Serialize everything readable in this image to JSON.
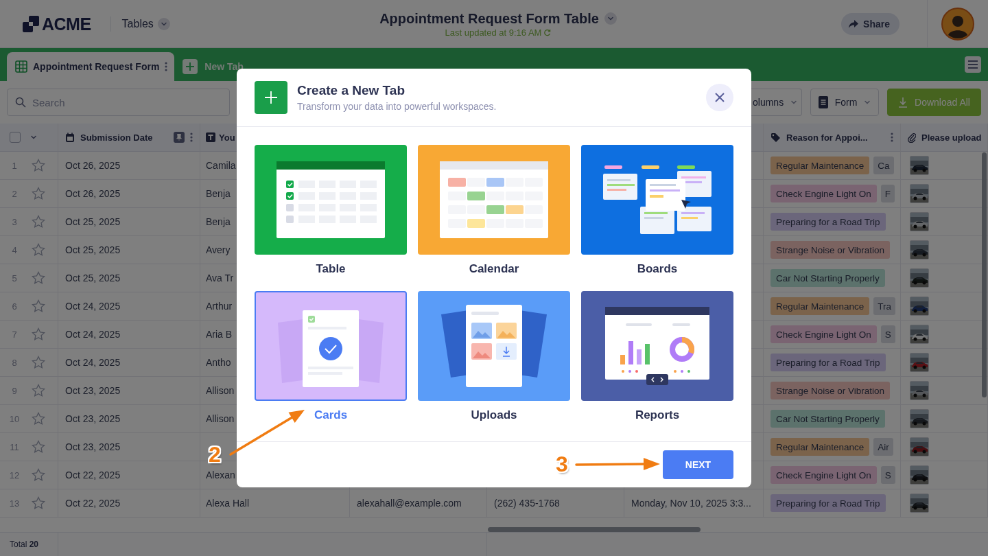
{
  "header": {
    "brand": "ACME",
    "section": "Tables",
    "title": "Appointment Request Form Table",
    "last_updated": "Last updated at 9:16 AM",
    "share": "Share"
  },
  "tabs": [
    {
      "label": "Appointment Request Form",
      "selected": true
    }
  ],
  "new_tab": "New Tab",
  "toolbar": {
    "search": {
      "placeholder": "Search"
    },
    "columns": "olumns",
    "view": "Form",
    "download": "Download All"
  },
  "table": {
    "select_all": {
      "checked": false
    },
    "columns": [
      {
        "kind": "date",
        "label": "Submission Date",
        "pinned": true
      },
      {
        "kind": "text",
        "label": "You"
      },
      {
        "kind": "tags",
        "label": "Reason for Appoi..."
      },
      {
        "kind": "file",
        "label": "Please upload"
      }
    ],
    "rows": [
      {
        "number": "1",
        "starred": false,
        "date": "Oct 26, 2025",
        "name": "Camila",
        "reason": {
          "text": "Regular Maintenance",
          "color": "#7b634b"
        },
        "more": "Ca"
      },
      {
        "number": "2",
        "starred": false,
        "date": "Oct 26, 2025",
        "name": "Benja",
        "reason": {
          "text": "Check Engine Light On",
          "color": "#7a6472"
        },
        "more": "F"
      },
      {
        "number": "3",
        "starred": false,
        "date": "Oct 25, 2025",
        "name": "Benja",
        "reason": {
          "text": "Preparing for a Road Trip",
          "color": "#6b667b"
        }
      },
      {
        "number": "4",
        "starred": false,
        "date": "Oct 25, 2025",
        "name": "Avery",
        "reason": {
          "text": "Strange Noise or Vibration",
          "color": "#7b6360"
        }
      },
      {
        "number": "5",
        "starred": false,
        "date": "Oct 25, 2025",
        "name": "Ava Tr",
        "reason": {
          "text": "Car Not Starting Properly",
          "color": "#5c726c"
        }
      },
      {
        "number": "6",
        "starred": false,
        "date": "Oct 24, 2025",
        "name": "Arthur",
        "reason": {
          "text": "Regular Maintenance",
          "color": "#7b634b"
        },
        "more": "Tra"
      },
      {
        "number": "7",
        "starred": false,
        "date": "Oct 24, 2025",
        "name": "Aria B",
        "reason": {
          "text": "Check Engine Light On",
          "color": "#7a6472"
        },
        "more": "S"
      },
      {
        "number": "8",
        "starred": false,
        "date": "Oct 24, 2025",
        "name": "Antho",
        "reason": {
          "text": "Preparing for a Road Trip",
          "color": "#6b667b"
        }
      },
      {
        "number": "9",
        "starred": false,
        "date": "Oct 23, 2025",
        "name": "Allison",
        "reason": {
          "text": "Strange Noise or Vibration",
          "color": "#7b6360"
        }
      },
      {
        "number": "10",
        "starred": false,
        "date": "Oct 23, 2025",
        "name": "Allison",
        "reason": {
          "text": "Car Not Starting Properly",
          "color": "#5c726c"
        }
      },
      {
        "number": "11",
        "starred": false,
        "date": "Oct 23, 2025",
        "reason": {
          "text": "Regular Maintenance",
          "color": "#7b634b"
        },
        "more": "Air"
      },
      {
        "number": "12",
        "starred": false,
        "date": "Oct 22, 2025",
        "name": "Alexan",
        "reason": {
          "text": "Check Engine Light On",
          "color": "#7a6472"
        },
        "more": "S"
      },
      {
        "number": "13",
        "starred": false,
        "date": "Oct 22, 2025",
        "name": "Alexa Hall",
        "email": "alexahall@example.com",
        "phone": "(262) 435-1768",
        "appointment": "Monday, Nov 10, 2025 3:3...",
        "reason": {
          "text": "Preparing for a Road Trip",
          "color": "#6b667b"
        }
      }
    ]
  },
  "footer": {
    "total": "Total **20**"
  },
  "modal": {
    "title": "Create a New Tab",
    "subtitle": "Transform your data into powerful workspaces.",
    "options": [
      {
        "kind": "table",
        "label": "Table",
        "selected": false
      },
      {
        "kind": "calendar",
        "label": "Calendar",
        "selected": false
      },
      {
        "kind": "boards",
        "label": "Boards",
        "selected": false
      },
      {
        "kind": "cards",
        "label": "Cards",
        "selected": true
      },
      {
        "kind": "uploads",
        "label": "Uploads",
        "selected": false
      },
      {
        "kind": "reports",
        "label": "Reports",
        "selected": false
      }
    ],
    "next": "NEXT"
  },
  "annotations": [
    {
      "label": "2"
    },
    {
      "label": "3"
    }
  ]
}
